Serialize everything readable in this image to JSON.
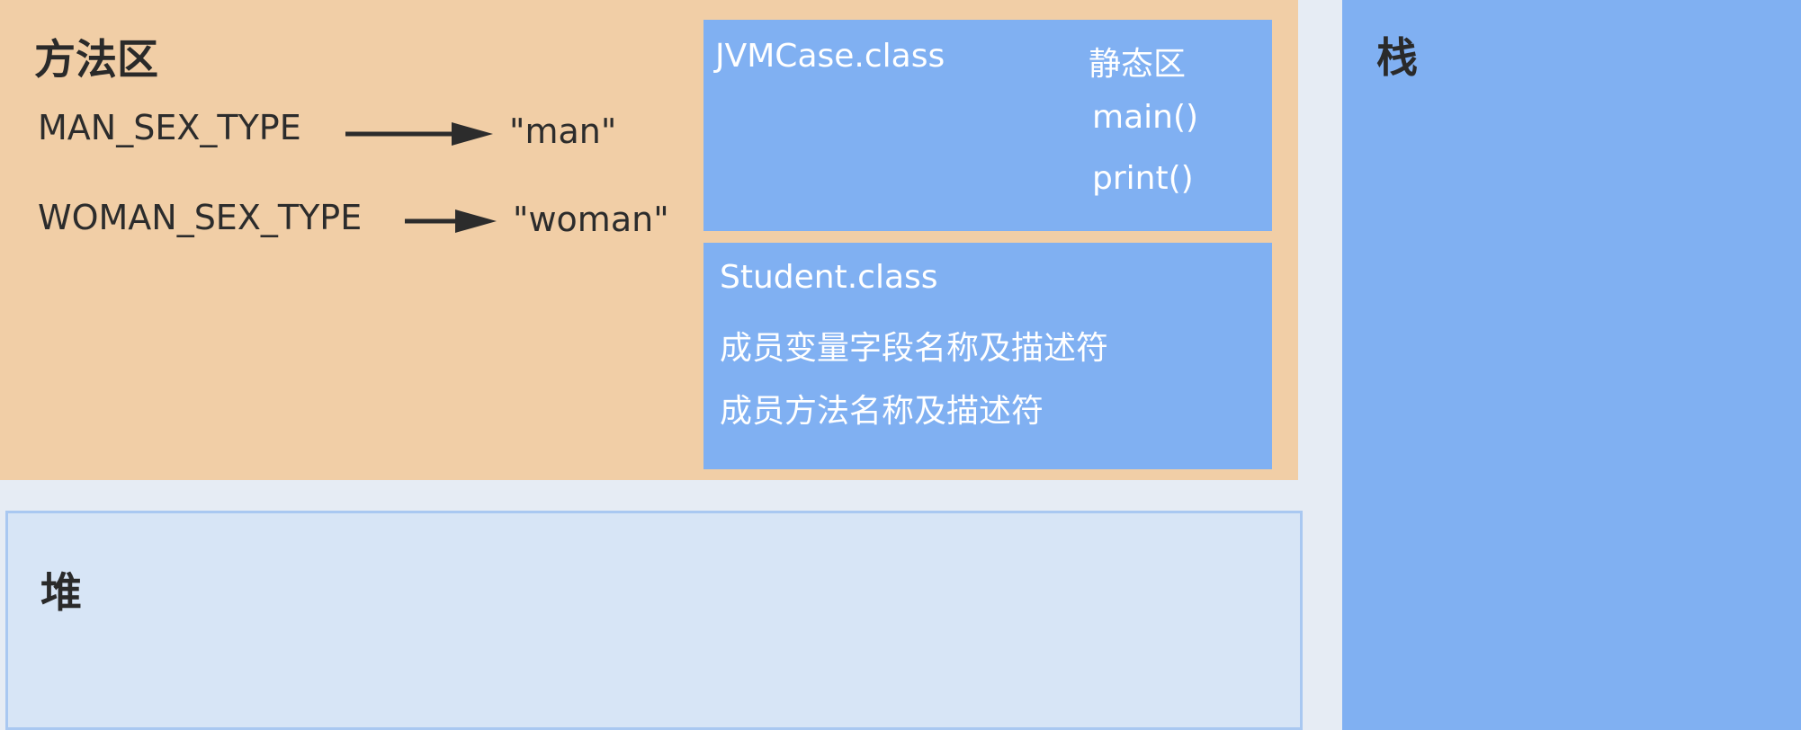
{
  "method_area": {
    "title": "方法区",
    "constants": [
      {
        "name": "MAN_SEX_TYPE",
        "value": "\"man\""
      },
      {
        "name": "WOMAN_SEX_TYPE",
        "value": "\"woman\""
      }
    ],
    "jvmcase_box": {
      "class_name": "JVMCase.class",
      "static_label": "静态区",
      "methods": [
        "main()",
        "print()"
      ]
    },
    "student_box": {
      "class_name": "Student.class",
      "lines": [
        "成员变量字段名称及描述符",
        "成员方法名称及描述符"
      ]
    }
  },
  "heap": {
    "title": "堆"
  },
  "stack": {
    "title": "栈"
  },
  "colors": {
    "method_area_bg": "#f1cea6",
    "class_box_bg": "#80b0f2",
    "heap_bg": "#d7e5f6",
    "heap_border": "#a9c8f1",
    "stack_bg": "#80b0f2",
    "page_bg": "#e6ecf4"
  }
}
